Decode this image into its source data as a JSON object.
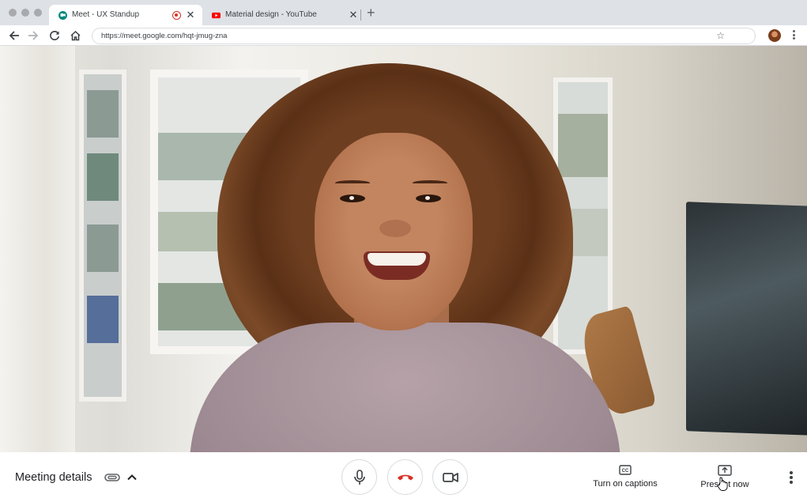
{
  "browser": {
    "tabs": [
      {
        "title": "Meet - UX Standup",
        "favicon": "google-meet-icon",
        "active": true,
        "recording": true
      },
      {
        "title": "Material design - YouTube",
        "favicon": "youtube-icon",
        "active": false
      }
    ],
    "address_bar": {
      "url": "https://meet.google.com/hqt-jmug-zna"
    }
  },
  "meeting": {
    "details_label": "Meeting details",
    "controls": {
      "mic": "mic-icon",
      "end_call": "end-call-icon",
      "camera": "camera-icon"
    },
    "actions": [
      {
        "label": "Turn on captions",
        "icon": "closed-captions-icon"
      },
      {
        "label": "Present now",
        "icon": "present-screen-icon"
      }
    ]
  },
  "colors": {
    "end_call_red": "#d93025",
    "tab_strip": "#dee1e6",
    "youtube_red": "#ff0000",
    "meet_green": "#00897b"
  }
}
